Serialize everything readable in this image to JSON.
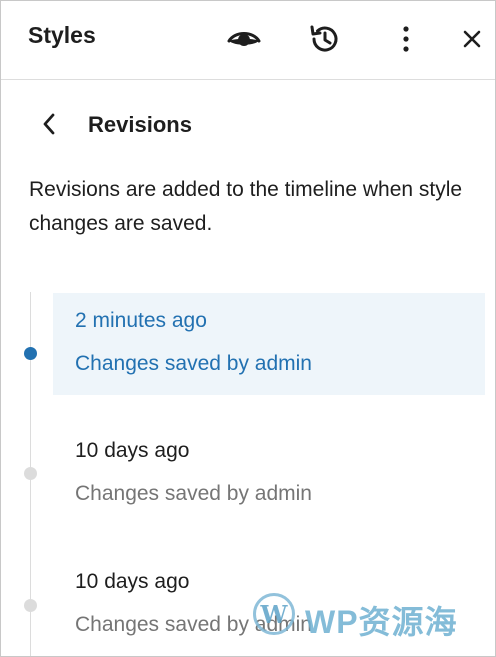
{
  "header": {
    "title": "Styles",
    "icons": [
      "eye-icon",
      "history-icon",
      "more-vertical-icon",
      "close-icon"
    ]
  },
  "subheader": {
    "back_icon": "chevron-left-icon",
    "title": "Revisions"
  },
  "description": "Revisions are added to the timeline when style changes are saved.",
  "revisions": [
    {
      "time": "2 minutes ago",
      "author": "Changes saved by admin",
      "selected": true
    },
    {
      "time": "10 days ago",
      "author": "Changes saved by admin",
      "selected": false
    },
    {
      "time": "10 days ago",
      "author": "Changes saved by admin",
      "selected": false
    }
  ],
  "watermark": {
    "logo": "W",
    "text": "WP资源海"
  },
  "colors": {
    "accent": "#2271b1",
    "selected_bg": "#eef5fa",
    "muted_text": "#757575",
    "timeline": "#dcdcdc"
  }
}
